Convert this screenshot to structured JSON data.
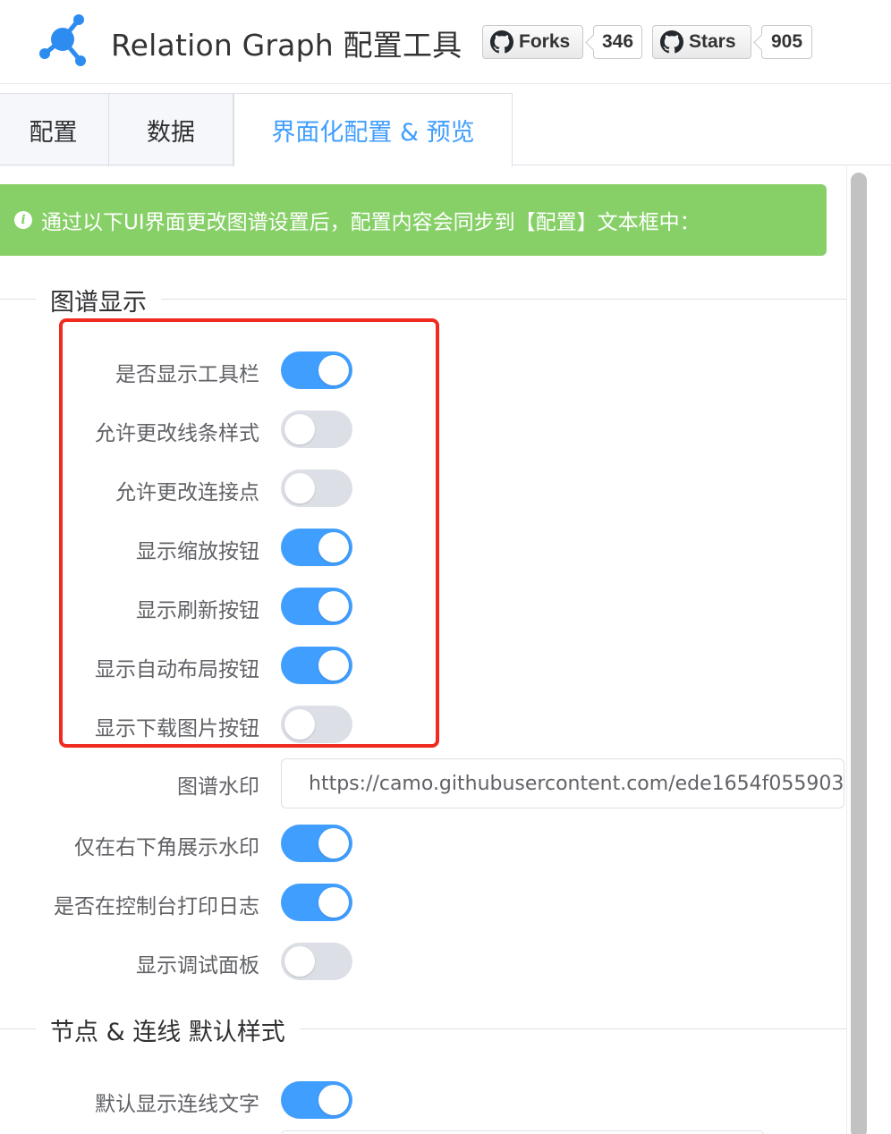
{
  "header": {
    "title": "Relation Graph 配置工具",
    "forks_label": "Forks",
    "forks_count": "346",
    "stars_label": "Stars",
    "stars_count": "905"
  },
  "tabs": [
    {
      "label": "配置"
    },
    {
      "label": "数据"
    },
    {
      "label": "界面化配置 & 预览"
    }
  ],
  "alert": {
    "text": "通过以下UI界面更改图谱设置后，配置内容会同步到【配置】文本框中："
  },
  "sections": {
    "graph_display": {
      "title": "图谱显示",
      "rows": [
        {
          "label": "是否显示工具栏",
          "on": true
        },
        {
          "label": "允许更改线条样式",
          "on": false
        },
        {
          "label": "允许更改连接点",
          "on": false
        },
        {
          "label": "显示缩放按钮",
          "on": true
        },
        {
          "label": "显示刷新按钮",
          "on": true
        },
        {
          "label": "显示自动布局按钮",
          "on": true
        },
        {
          "label": "显示下载图片按钮",
          "on": false
        }
      ],
      "watermark_label": "图谱水印",
      "watermark_value": "https://camo.githubusercontent.com/ede1654f055903",
      "rows2": [
        {
          "label": "仅在右下角展示水印",
          "on": true
        },
        {
          "label": "是否在控制台打印日志",
          "on": true
        },
        {
          "label": "显示调试面板",
          "on": false
        }
      ]
    },
    "node_line_style": {
      "title": "节点 & 连线 默认样式",
      "rows": [
        {
          "label": "默认显示连线文字",
          "on": true
        }
      ]
    }
  },
  "colors": {
    "accent": "#409eff",
    "alert_bg": "#87d068",
    "highlight": "#f02b1e",
    "switch_off": "#dcdfe6"
  }
}
